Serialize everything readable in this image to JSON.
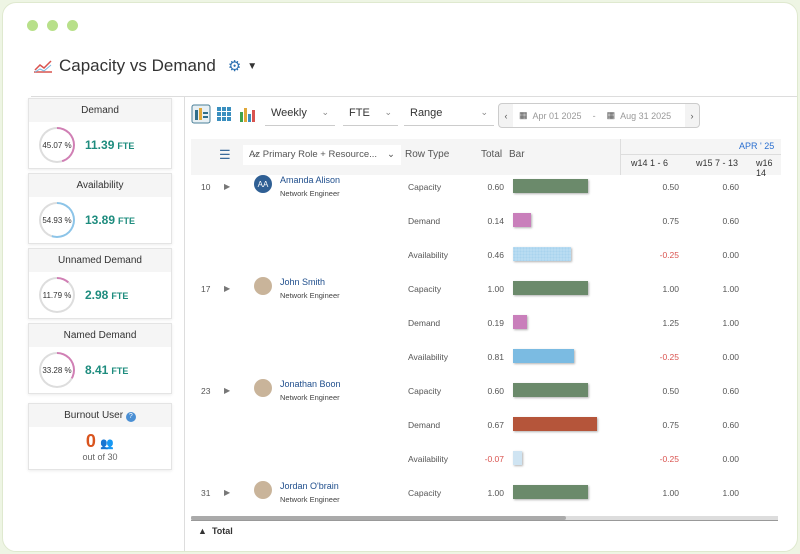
{
  "title": "Capacity vs Demand",
  "kpis": [
    {
      "label": "Demand",
      "percent": "45.07 %",
      "pct": 45.07,
      "value": "11.39",
      "unit": "FTE",
      "color": "#d07fb4"
    },
    {
      "label": "Availability",
      "percent": "54.93 %",
      "pct": 54.93,
      "value": "13.89",
      "unit": "FTE",
      "color": "#8cc4e8"
    },
    {
      "label": "Unnamed Demand",
      "percent": "11.79 %",
      "pct": 11.79,
      "value": "2.98",
      "unit": "FTE",
      "color": "#d07fb4"
    },
    {
      "label": "Named Demand",
      "percent": "33.28 %",
      "pct": 33.28,
      "value": "8.41",
      "unit": "FTE",
      "color": "#d07fb4"
    }
  ],
  "burnout": {
    "label": "Burnout User",
    "count": "0",
    "out_of": "out of 30"
  },
  "toolbar": {
    "period": "Weekly",
    "unit": "FTE",
    "range": "Range",
    "start": "Apr 01 2025",
    "sep": "-",
    "end": "Aug 31 2025"
  },
  "grid": {
    "group_by": "Primary Role + Resource...",
    "row_type": "Row Type",
    "total": "Total",
    "bar": "Bar",
    "month": "APR ' 25",
    "weeks": [
      "w14  1 - 6",
      "w15  7 - 13",
      "w16  14"
    ],
    "footer": "Total"
  },
  "people": [
    {
      "idx": "10",
      "name": "Amanda Alison",
      "role": "Network Engineer",
      "initials": "AA",
      "rows": [
        {
          "type": "Capacity",
          "total": "0.60",
          "w": [
            "0.50",
            "0.60"
          ]
        },
        {
          "type": "Demand",
          "total": "0.14",
          "w": [
            "0.75",
            "0.60"
          ]
        },
        {
          "type": "Availability",
          "total": "0.46",
          "w": [
            "-0.25",
            "0.00"
          ]
        }
      ]
    },
    {
      "idx": "17",
      "name": "John Smith",
      "role": "Network Engineer",
      "initials": "",
      "rows": [
        {
          "type": "Capacity",
          "total": "1.00",
          "w": [
            "1.00",
            "1.00"
          ]
        },
        {
          "type": "Demand",
          "total": "0.19",
          "w": [
            "1.25",
            "1.00"
          ]
        },
        {
          "type": "Availability",
          "total": "0.81",
          "w": [
            "-0.25",
            "0.00"
          ]
        }
      ]
    },
    {
      "idx": "23",
      "name": "Jonathan Boon",
      "role": "Network Engineer",
      "initials": "",
      "rows": [
        {
          "type": "Capacity",
          "total": "0.60",
          "w": [
            "0.50",
            "0.60"
          ]
        },
        {
          "type": "Demand",
          "total": "0.67",
          "w": [
            "0.75",
            "0.60"
          ]
        },
        {
          "type": "Availability",
          "total": "-0.07",
          "w": [
            "-0.25",
            "0.00"
          ]
        }
      ]
    },
    {
      "idx": "31",
      "name": "Jordan O'brain",
      "role": "Network Engineer",
      "initials": "",
      "rows": [
        {
          "type": "Capacity",
          "total": "1.00",
          "w": [
            "1.00",
            "1.00"
          ]
        }
      ]
    }
  ],
  "colors": {
    "capacity": "#6b8a6b",
    "demand": "#c97fbb",
    "over_demand": "#b5553a",
    "availability": "#7bbbe2",
    "negative": "#d9534f",
    "accent": "#1e8c7e"
  }
}
